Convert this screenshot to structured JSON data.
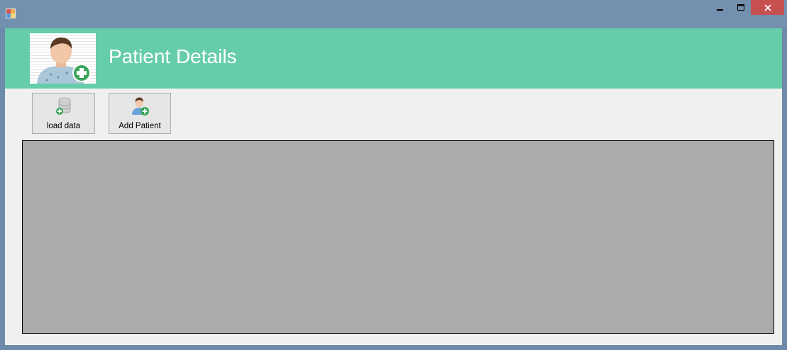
{
  "window": {
    "title": "",
    "icon": "app-form-icon",
    "controls": {
      "minimize": "minimize-icon",
      "maximize": "maximize-icon",
      "close": "close-icon"
    }
  },
  "header": {
    "title": "Patient Details",
    "background": "#66cdaa",
    "avatar_icon": "patient-add-avatar-icon"
  },
  "toolbar": {
    "load_label": "load data",
    "load_icon": "database-add-icon",
    "add_label": "Add Patient",
    "add_icon": "user-add-icon"
  },
  "grid": {
    "background": "#ababab",
    "rows": []
  }
}
